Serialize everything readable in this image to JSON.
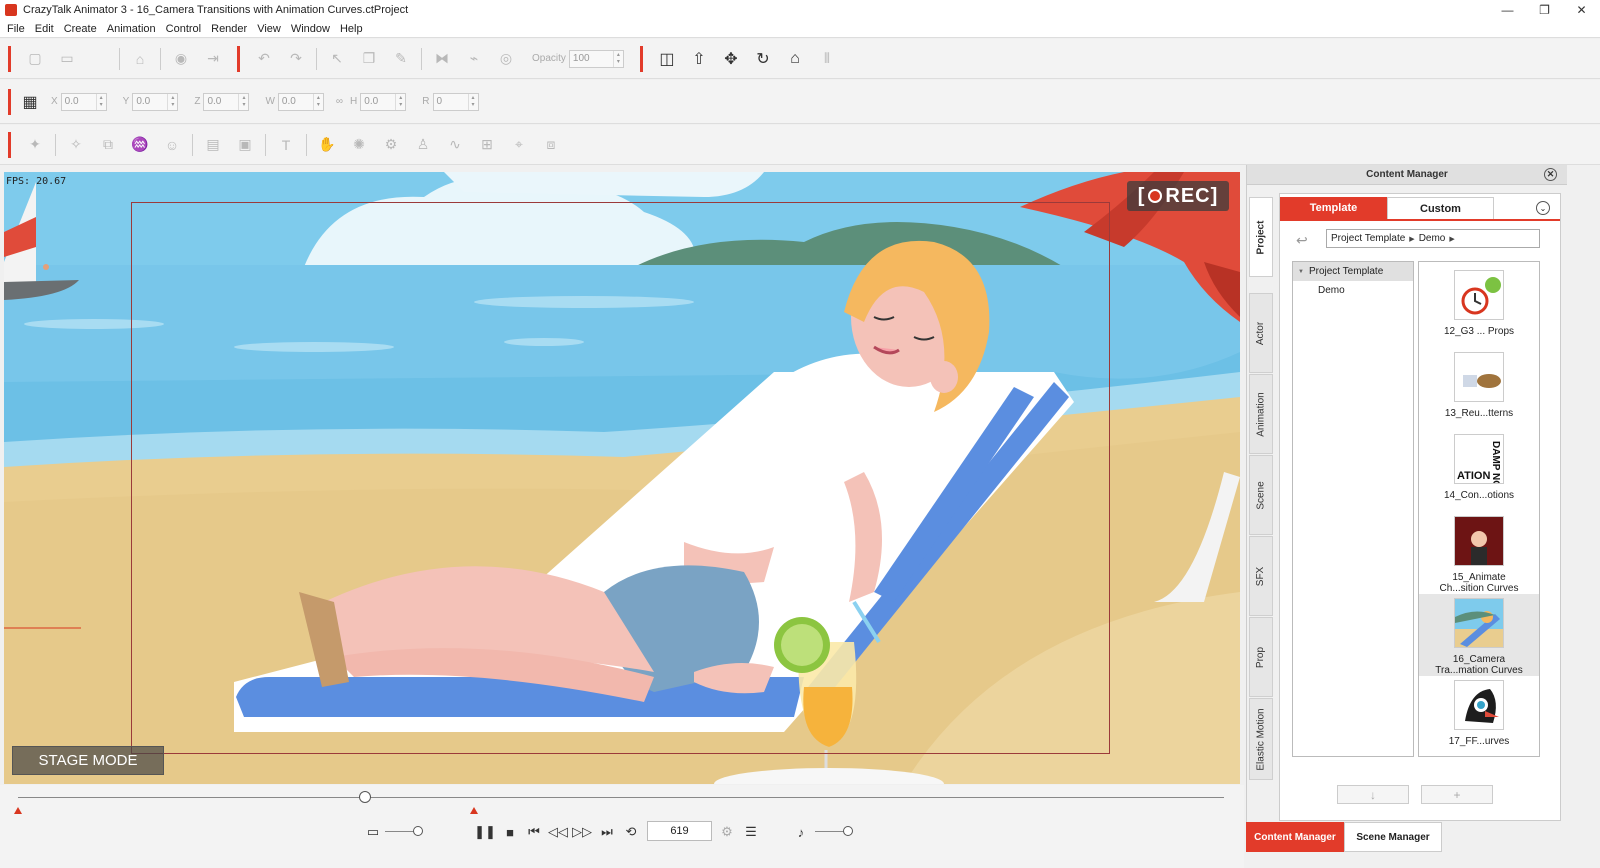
{
  "window": {
    "title": "CrazyTalk Animator 3  - 16_Camera Transitions with Animation Curves.ctProject",
    "controls": [
      "—",
      "❐",
      "✕"
    ]
  },
  "menu": [
    "File",
    "Edit",
    "Create",
    "Animation",
    "Control",
    "Render",
    "View",
    "Window",
    "Help"
  ],
  "toolbar1": {
    "opacity_label": "Opacity",
    "opacity_value": "100"
  },
  "toolbar2": {
    "fields": [
      {
        "label": "X",
        "value": "0.0"
      },
      {
        "label": "Y",
        "value": "0.0"
      },
      {
        "label": "Z",
        "value": "0.0"
      },
      {
        "label": "W",
        "value": "0.0"
      },
      {
        "label": "H",
        "value": "0.0"
      },
      {
        "label": "R",
        "value": "0"
      }
    ]
  },
  "stage": {
    "fps": "FPS: 20.67",
    "rec": "REC",
    "mode": "STAGE MODE"
  },
  "timeline": {
    "frame": "619"
  },
  "content_manager": {
    "title": "Content Manager",
    "tabs": [
      "Template",
      "Custom"
    ],
    "side_tabs": [
      "Project",
      "Actor",
      "Animation",
      "Scene",
      "SFX",
      "Prop",
      "Elastic Motion"
    ],
    "path": [
      "Project Template",
      "Demo"
    ],
    "tree": [
      {
        "label": "Project Template",
        "selected": true
      },
      {
        "label": "Demo",
        "selected": false
      }
    ],
    "items": [
      {
        "label": "12_G3 ... Props"
      },
      {
        "label": "13_Reu...tterns"
      },
      {
        "label": "14_Con...otions",
        "thumb_text": "DAMP NG ATION"
      },
      {
        "label": "15_Animate Ch...sition Curves"
      },
      {
        "label": "16_Camera Tra...mation Curves",
        "selected": true
      },
      {
        "label": "17_FF...urves"
      }
    ],
    "footer": [
      "↓",
      "+"
    ]
  },
  "bottom_tabs": [
    "Content Manager",
    "Scene Manager"
  ],
  "colors": {
    "accent": "#e23b2a",
    "sky": "#7ecbec",
    "sand": "#e9cd8f"
  }
}
